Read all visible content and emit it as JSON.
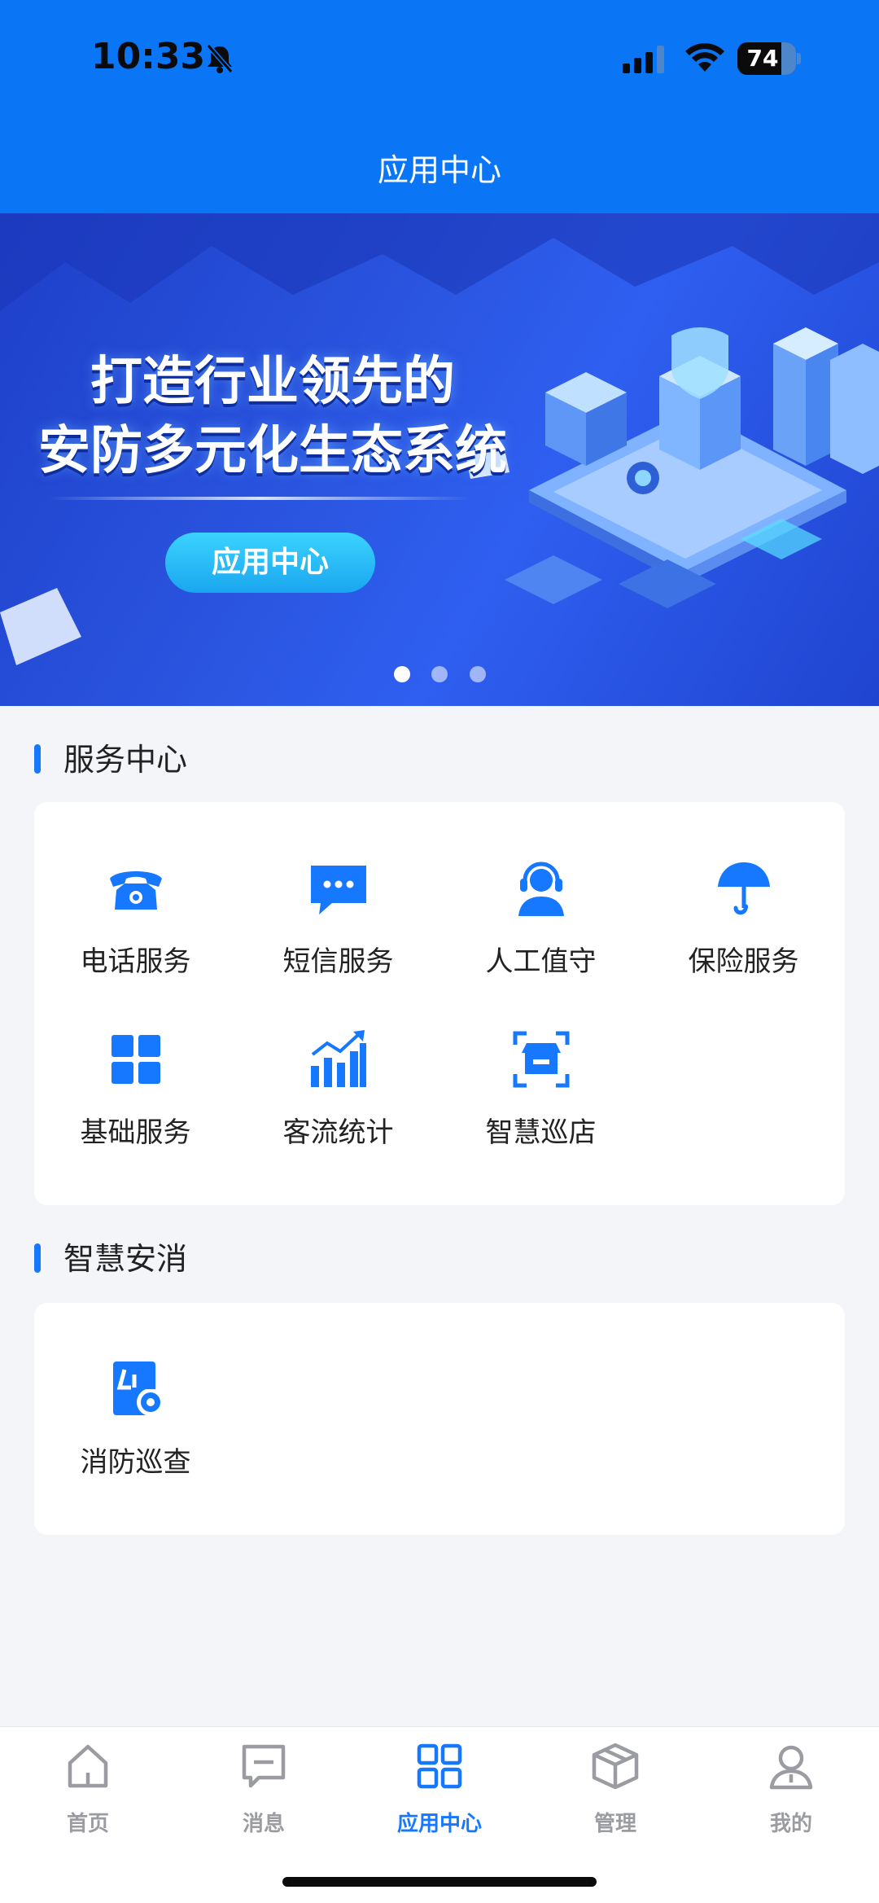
{
  "status_bar": {
    "time": "10:33",
    "battery": "74"
  },
  "header": {
    "title": "应用中心"
  },
  "banner": {
    "title_line1": "打造行业领先的",
    "title_line2": "安防多元化生态系统",
    "button_label": "应用中心",
    "page_count": 3,
    "active_page": 1
  },
  "service_center": {
    "title": "服务中心",
    "items": [
      {
        "label": "电话服务",
        "icon": "telephone-icon"
      },
      {
        "label": "短信服务",
        "icon": "sms-icon"
      },
      {
        "label": "人工值守",
        "icon": "headset-agent-icon"
      },
      {
        "label": "保险服务",
        "icon": "umbrella-icon"
      },
      {
        "label": "基础服务",
        "icon": "grid-icon"
      },
      {
        "label": "客流统计",
        "icon": "bar-chart-icon"
      },
      {
        "label": "智慧巡店",
        "icon": "store-scan-icon"
      }
    ]
  },
  "smart_fire": {
    "title": "智慧安消",
    "items": [
      {
        "label": "消防巡查",
        "icon": "fire-inspection-icon"
      }
    ]
  },
  "tabbar": {
    "items": [
      {
        "label": "首页",
        "icon": "home-icon",
        "active": false
      },
      {
        "label": "消息",
        "icon": "message-icon",
        "active": false
      },
      {
        "label": "应用中心",
        "icon": "apps-icon",
        "active": true
      },
      {
        "label": "管理",
        "icon": "box-icon",
        "active": false
      },
      {
        "label": "我的",
        "icon": "user-icon",
        "active": false
      }
    ]
  },
  "colors": {
    "primary": "#0a75f5",
    "accent": "#1677ff",
    "inactive": "#9a9ca2",
    "background": "#f3f5f8"
  }
}
